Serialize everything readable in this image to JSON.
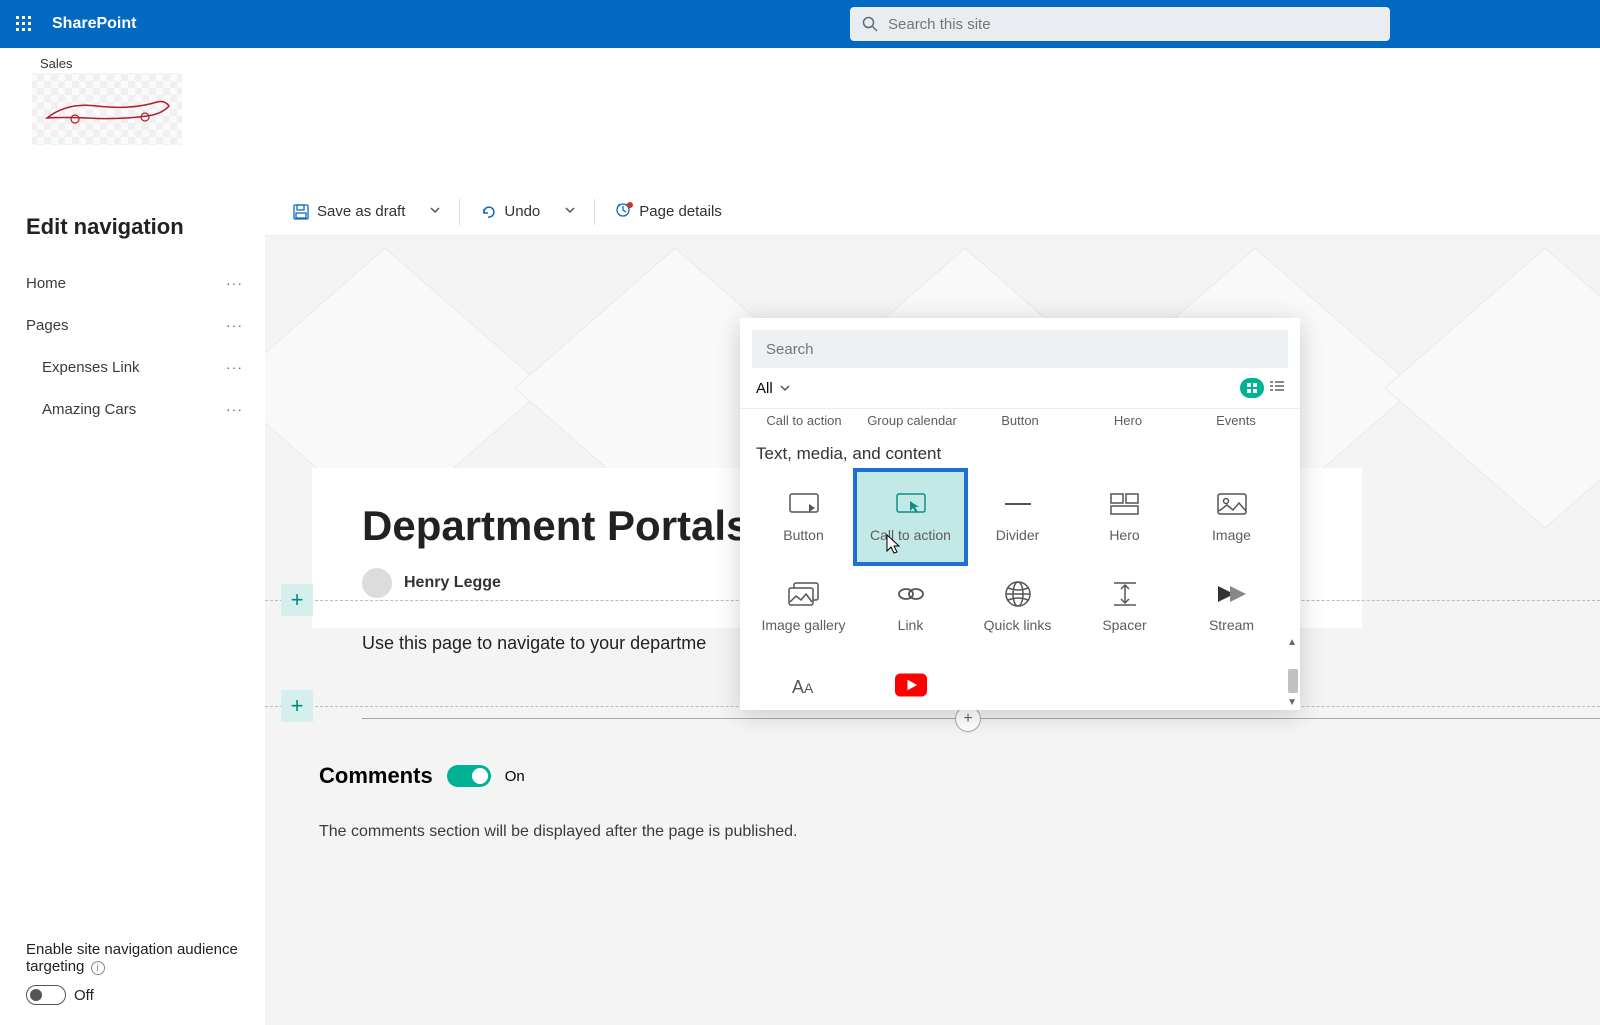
{
  "suite": {
    "app_name": "SharePoint",
    "search_placeholder": "Search this site"
  },
  "site": {
    "title": "Sales"
  },
  "nav": {
    "heading": "Edit navigation",
    "items": [
      {
        "label": "Home",
        "child": false
      },
      {
        "label": "Pages",
        "child": false
      },
      {
        "label": "Expenses Link",
        "child": true
      },
      {
        "label": "Amazing Cars",
        "child": true
      }
    ],
    "footer_label": "Enable site navigation audience targeting",
    "footer_toggle": "Off"
  },
  "cmdbar": {
    "save": "Save as draft",
    "undo": "Undo",
    "page_details": "Page details"
  },
  "page": {
    "title": "Department Portals",
    "author": "Henry Legge",
    "body_text": "Use this page to navigate to your departme"
  },
  "comments": {
    "title": "Comments",
    "state": "On",
    "note": "The comments section will be displayed after the page is published."
  },
  "picker": {
    "search_placeholder": "Search",
    "filter": "All",
    "partial_row": [
      "Call to action",
      "Group calendar",
      "Button",
      "Hero",
      "Events"
    ],
    "section_label": "Text, media, and content",
    "row1": [
      "Button",
      "Call to action",
      "Divider",
      "Hero",
      "Image"
    ],
    "row2": [
      "Image gallery",
      "Link",
      "Quick links",
      "Spacer",
      "Stream"
    ]
  }
}
